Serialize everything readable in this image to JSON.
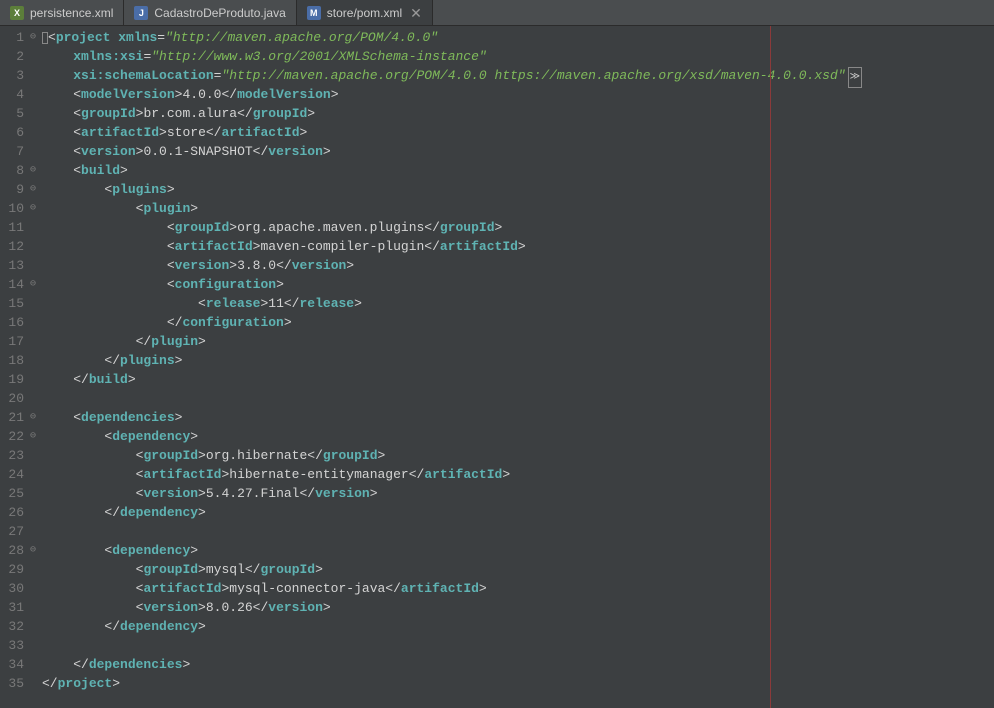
{
  "tabs": [
    {
      "icon": "X",
      "iconClass": "icon-xml",
      "label": "persistence.xml",
      "active": false,
      "closeable": false
    },
    {
      "icon": "J",
      "iconClass": "icon-java",
      "label": "CadastroDeProduto.java",
      "active": false,
      "closeable": false
    },
    {
      "icon": "M",
      "iconClass": "icon-maven",
      "label": "store/pom.xml",
      "active": true,
      "closeable": true
    }
  ],
  "lines": [
    {
      "n": 1,
      "mark": "⊖",
      "ind": 0,
      "seg": [
        {
          "t": "cursor"
        },
        {
          "t": "b",
          "v": "<"
        },
        {
          "t": "tag",
          "v": "project"
        },
        {
          "t": "txt",
          "v": " "
        },
        {
          "t": "attr",
          "v": "xmlns"
        },
        {
          "t": "eq",
          "v": "="
        },
        {
          "t": "str",
          "v": "\"http://maven.apache.org/POM/4.0.0\""
        }
      ]
    },
    {
      "n": 2,
      "mark": "",
      "ind": 1,
      "seg": [
        {
          "t": "attr",
          "v": "xmlns:xsi"
        },
        {
          "t": "eq",
          "v": "="
        },
        {
          "t": "str",
          "v": "\"http://www.w3.org/2001/XMLSchema-instance\""
        }
      ]
    },
    {
      "n": 3,
      "mark": "",
      "ind": 1,
      "seg": [
        {
          "t": "attr",
          "v": "xsi:schemaLocation"
        },
        {
          "t": "eq",
          "v": "="
        },
        {
          "t": "str",
          "v": "\"http://maven.apache.org/POM/4.0.0 https://maven.apache.org/xsd/maven-4.0.0.xsd\""
        },
        {
          "t": "ovf"
        }
      ]
    },
    {
      "n": 4,
      "mark": "",
      "ind": 1,
      "seg": [
        {
          "t": "b",
          "v": "<"
        },
        {
          "t": "tag",
          "v": "modelVersion"
        },
        {
          "t": "b",
          "v": ">"
        },
        {
          "t": "txt",
          "v": "4.0.0"
        },
        {
          "t": "b",
          "v": "</"
        },
        {
          "t": "tag",
          "v": "modelVersion"
        },
        {
          "t": "b",
          "v": ">"
        }
      ]
    },
    {
      "n": 5,
      "mark": "",
      "ind": 1,
      "seg": [
        {
          "t": "b",
          "v": "<"
        },
        {
          "t": "tag",
          "v": "groupId"
        },
        {
          "t": "b",
          "v": ">"
        },
        {
          "t": "txt",
          "v": "br.com.alura"
        },
        {
          "t": "b",
          "v": "</"
        },
        {
          "t": "tag",
          "v": "groupId"
        },
        {
          "t": "b",
          "v": ">"
        }
      ]
    },
    {
      "n": 6,
      "mark": "",
      "ind": 1,
      "seg": [
        {
          "t": "b",
          "v": "<"
        },
        {
          "t": "tag",
          "v": "artifactId"
        },
        {
          "t": "b",
          "v": ">"
        },
        {
          "t": "txt",
          "v": "store"
        },
        {
          "t": "b",
          "v": "</"
        },
        {
          "t": "tag",
          "v": "artifactId"
        },
        {
          "t": "b",
          "v": ">"
        }
      ]
    },
    {
      "n": 7,
      "mark": "",
      "ind": 1,
      "seg": [
        {
          "t": "b",
          "v": "<"
        },
        {
          "t": "tag",
          "v": "version"
        },
        {
          "t": "b",
          "v": ">"
        },
        {
          "t": "txt",
          "v": "0.0.1-SNAPSHOT"
        },
        {
          "t": "b",
          "v": "</"
        },
        {
          "t": "tag",
          "v": "version"
        },
        {
          "t": "b",
          "v": ">"
        }
      ]
    },
    {
      "n": 8,
      "mark": "⊖",
      "ind": 1,
      "seg": [
        {
          "t": "b",
          "v": "<"
        },
        {
          "t": "tag",
          "v": "build"
        },
        {
          "t": "b",
          "v": ">"
        }
      ]
    },
    {
      "n": 9,
      "mark": "⊖",
      "ind": 2,
      "seg": [
        {
          "t": "b",
          "v": "<"
        },
        {
          "t": "tag",
          "v": "plugins"
        },
        {
          "t": "b",
          "v": ">"
        }
      ]
    },
    {
      "n": 10,
      "mark": "⊖",
      "ind": 3,
      "seg": [
        {
          "t": "b",
          "v": "<"
        },
        {
          "t": "tag",
          "v": "plugin"
        },
        {
          "t": "b",
          "v": ">"
        }
      ]
    },
    {
      "n": 11,
      "mark": "",
      "ind": 4,
      "seg": [
        {
          "t": "b",
          "v": "<"
        },
        {
          "t": "tag",
          "v": "groupId"
        },
        {
          "t": "b",
          "v": ">"
        },
        {
          "t": "txt",
          "v": "org.apache.maven.plugins"
        },
        {
          "t": "b",
          "v": "</"
        },
        {
          "t": "tag",
          "v": "groupId"
        },
        {
          "t": "b",
          "v": ">"
        }
      ]
    },
    {
      "n": 12,
      "mark": "",
      "ind": 4,
      "seg": [
        {
          "t": "b",
          "v": "<"
        },
        {
          "t": "tag",
          "v": "artifactId"
        },
        {
          "t": "b",
          "v": ">"
        },
        {
          "t": "txt",
          "v": "maven-compiler-plugin"
        },
        {
          "t": "b",
          "v": "</"
        },
        {
          "t": "tag",
          "v": "artifactId"
        },
        {
          "t": "b",
          "v": ">"
        }
      ]
    },
    {
      "n": 13,
      "mark": "",
      "ind": 4,
      "seg": [
        {
          "t": "b",
          "v": "<"
        },
        {
          "t": "tag",
          "v": "version"
        },
        {
          "t": "b",
          "v": ">"
        },
        {
          "t": "txt",
          "v": "3.8.0"
        },
        {
          "t": "b",
          "v": "</"
        },
        {
          "t": "tag",
          "v": "version"
        },
        {
          "t": "b",
          "v": ">"
        }
      ]
    },
    {
      "n": 14,
      "mark": "⊖",
      "ind": 4,
      "seg": [
        {
          "t": "b",
          "v": "<"
        },
        {
          "t": "tag",
          "v": "configuration"
        },
        {
          "t": "b",
          "v": ">"
        }
      ]
    },
    {
      "n": 15,
      "mark": "",
      "ind": 5,
      "seg": [
        {
          "t": "b",
          "v": "<"
        },
        {
          "t": "tag",
          "v": "release"
        },
        {
          "t": "b",
          "v": ">"
        },
        {
          "t": "txt",
          "v": "11"
        },
        {
          "t": "b",
          "v": "</"
        },
        {
          "t": "tag",
          "v": "release"
        },
        {
          "t": "b",
          "v": ">"
        }
      ]
    },
    {
      "n": 16,
      "mark": "",
      "ind": 4,
      "seg": [
        {
          "t": "b",
          "v": "</"
        },
        {
          "t": "tag",
          "v": "configuration"
        },
        {
          "t": "b",
          "v": ">"
        }
      ]
    },
    {
      "n": 17,
      "mark": "",
      "ind": 3,
      "seg": [
        {
          "t": "b",
          "v": "</"
        },
        {
          "t": "tag",
          "v": "plugin"
        },
        {
          "t": "b",
          "v": ">"
        }
      ]
    },
    {
      "n": 18,
      "mark": "",
      "ind": 2,
      "seg": [
        {
          "t": "b",
          "v": "</"
        },
        {
          "t": "tag",
          "v": "plugins"
        },
        {
          "t": "b",
          "v": ">"
        }
      ]
    },
    {
      "n": 19,
      "mark": "",
      "ind": 1,
      "seg": [
        {
          "t": "b",
          "v": "</"
        },
        {
          "t": "tag",
          "v": "build"
        },
        {
          "t": "b",
          "v": ">"
        }
      ]
    },
    {
      "n": 20,
      "mark": "",
      "ind": 0,
      "seg": []
    },
    {
      "n": 21,
      "mark": "⊖",
      "ind": 1,
      "seg": [
        {
          "t": "b",
          "v": "<"
        },
        {
          "t": "tag",
          "v": "dependencies"
        },
        {
          "t": "b",
          "v": ">"
        }
      ]
    },
    {
      "n": 22,
      "mark": "⊖",
      "ind": 2,
      "seg": [
        {
          "t": "b",
          "v": "<"
        },
        {
          "t": "tag",
          "v": "dependency"
        },
        {
          "t": "b",
          "v": ">"
        }
      ]
    },
    {
      "n": 23,
      "mark": "",
      "ind": 3,
      "seg": [
        {
          "t": "b",
          "v": "<"
        },
        {
          "t": "tag",
          "v": "groupId"
        },
        {
          "t": "b",
          "v": ">"
        },
        {
          "t": "txt",
          "v": "org.hibernate"
        },
        {
          "t": "b",
          "v": "</"
        },
        {
          "t": "tag",
          "v": "groupId"
        },
        {
          "t": "b",
          "v": ">"
        }
      ]
    },
    {
      "n": 24,
      "mark": "",
      "ind": 3,
      "seg": [
        {
          "t": "b",
          "v": "<"
        },
        {
          "t": "tag",
          "v": "artifactId"
        },
        {
          "t": "b",
          "v": ">"
        },
        {
          "t": "txt",
          "v": "hibernate-entitymanager"
        },
        {
          "t": "b",
          "v": "</"
        },
        {
          "t": "tag",
          "v": "artifactId"
        },
        {
          "t": "b",
          "v": ">"
        }
      ]
    },
    {
      "n": 25,
      "mark": "",
      "ind": 3,
      "seg": [
        {
          "t": "b",
          "v": "<"
        },
        {
          "t": "tag",
          "v": "version"
        },
        {
          "t": "b",
          "v": ">"
        },
        {
          "t": "txt",
          "v": "5.4.27.Final"
        },
        {
          "t": "b",
          "v": "</"
        },
        {
          "t": "tag",
          "v": "version"
        },
        {
          "t": "b",
          "v": ">"
        }
      ]
    },
    {
      "n": 26,
      "mark": "",
      "ind": 2,
      "seg": [
        {
          "t": "b",
          "v": "</"
        },
        {
          "t": "tag",
          "v": "dependency"
        },
        {
          "t": "b",
          "v": ">"
        }
      ]
    },
    {
      "n": 27,
      "mark": "",
      "ind": 0,
      "seg": []
    },
    {
      "n": 28,
      "mark": "⊖",
      "ind": 2,
      "seg": [
        {
          "t": "b",
          "v": "<"
        },
        {
          "t": "tag",
          "v": "dependency"
        },
        {
          "t": "b",
          "v": ">"
        }
      ]
    },
    {
      "n": 29,
      "mark": "",
      "ind": 3,
      "seg": [
        {
          "t": "b",
          "v": "<"
        },
        {
          "t": "tag",
          "v": "groupId"
        },
        {
          "t": "b",
          "v": ">"
        },
        {
          "t": "txt",
          "v": "mysql"
        },
        {
          "t": "b",
          "v": "</"
        },
        {
          "t": "tag",
          "v": "groupId"
        },
        {
          "t": "b",
          "v": ">"
        }
      ]
    },
    {
      "n": 30,
      "mark": "",
      "ind": 3,
      "seg": [
        {
          "t": "b",
          "v": "<"
        },
        {
          "t": "tag",
          "v": "artifactId"
        },
        {
          "t": "b",
          "v": ">"
        },
        {
          "t": "txt",
          "v": "mysql-connector-java"
        },
        {
          "t": "b",
          "v": "</"
        },
        {
          "t": "tag",
          "v": "artifactId"
        },
        {
          "t": "b",
          "v": ">"
        }
      ]
    },
    {
      "n": 31,
      "mark": "",
      "ind": 3,
      "seg": [
        {
          "t": "b",
          "v": "<"
        },
        {
          "t": "tag",
          "v": "version"
        },
        {
          "t": "b",
          "v": ">"
        },
        {
          "t": "txt",
          "v": "8.0.26"
        },
        {
          "t": "b",
          "v": "</"
        },
        {
          "t": "tag",
          "v": "version"
        },
        {
          "t": "b",
          "v": ">"
        }
      ]
    },
    {
      "n": 32,
      "mark": "",
      "ind": 2,
      "seg": [
        {
          "t": "b",
          "v": "</"
        },
        {
          "t": "tag",
          "v": "dependency"
        },
        {
          "t": "b",
          "v": ">"
        }
      ]
    },
    {
      "n": 33,
      "mark": "",
      "ind": 0,
      "seg": []
    },
    {
      "n": 34,
      "mark": "",
      "ind": 1,
      "seg": [
        {
          "t": "b",
          "v": "</"
        },
        {
          "t": "tag",
          "v": "dependencies"
        },
        {
          "t": "b",
          "v": ">"
        }
      ]
    },
    {
      "n": 35,
      "mark": "",
      "ind": 0,
      "seg": [
        {
          "t": "b",
          "v": "</"
        },
        {
          "t": "tag",
          "v": "project"
        },
        {
          "t": "b",
          "v": ">"
        }
      ]
    }
  ]
}
